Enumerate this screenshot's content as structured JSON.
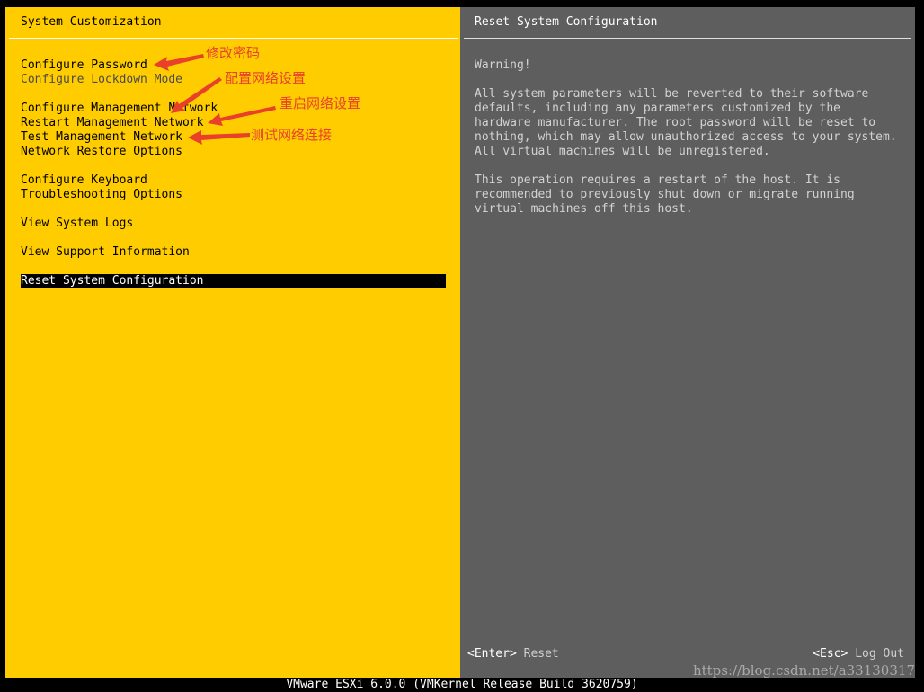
{
  "left_panel": {
    "title": "System Customization",
    "menu_items": [
      {
        "label": "Configure Password"
      },
      {
        "label": "Configure Lockdown Mode"
      },
      {
        "label": "Configure Management Network"
      },
      {
        "label": "Restart Management Network"
      },
      {
        "label": "Test Management Network"
      },
      {
        "label": "Network Restore Options"
      },
      {
        "label": "Configure Keyboard"
      },
      {
        "label": "Troubleshooting Options"
      },
      {
        "label": "View System Logs"
      },
      {
        "label": "View Support Information"
      },
      {
        "label": "Reset System Configuration"
      }
    ],
    "selected_item": "Reset System Configuration"
  },
  "right_panel": {
    "title": "Reset System Configuration",
    "warning": "Warning!",
    "paragraph1": [
      "All system parameters will be reverted to their software",
      "defaults, including any parameters customized by the",
      "hardware manufacturer. The root password will be reset to",
      "nothing, which may allow unauthorized access to your system.",
      "All virtual machines will be unregistered."
    ],
    "paragraph2": [
      "This operation requires a restart of the host. It is",
      "recommended to previously shut down or migrate running",
      "virtual machines off this host."
    ],
    "enter_key": "<Enter>",
    "enter_action": "Reset",
    "esc_key": "<Esc>",
    "esc_action": "Log Out"
  },
  "status_bar": {
    "text": "VMware ESXi 6.0.0 (VMKernel Release Build 3620759)"
  },
  "watermark": "https://blog.csdn.net/a33130317",
  "annotations": {
    "a1": "修改密码",
    "a2": "配置网络设置",
    "a3": "重启网络设置",
    "a4": "测试网络连接"
  },
  "colors": {
    "left_bg": "#FFCC00",
    "right_bg": "#5E5E5E",
    "annotation": "#E8402A"
  }
}
